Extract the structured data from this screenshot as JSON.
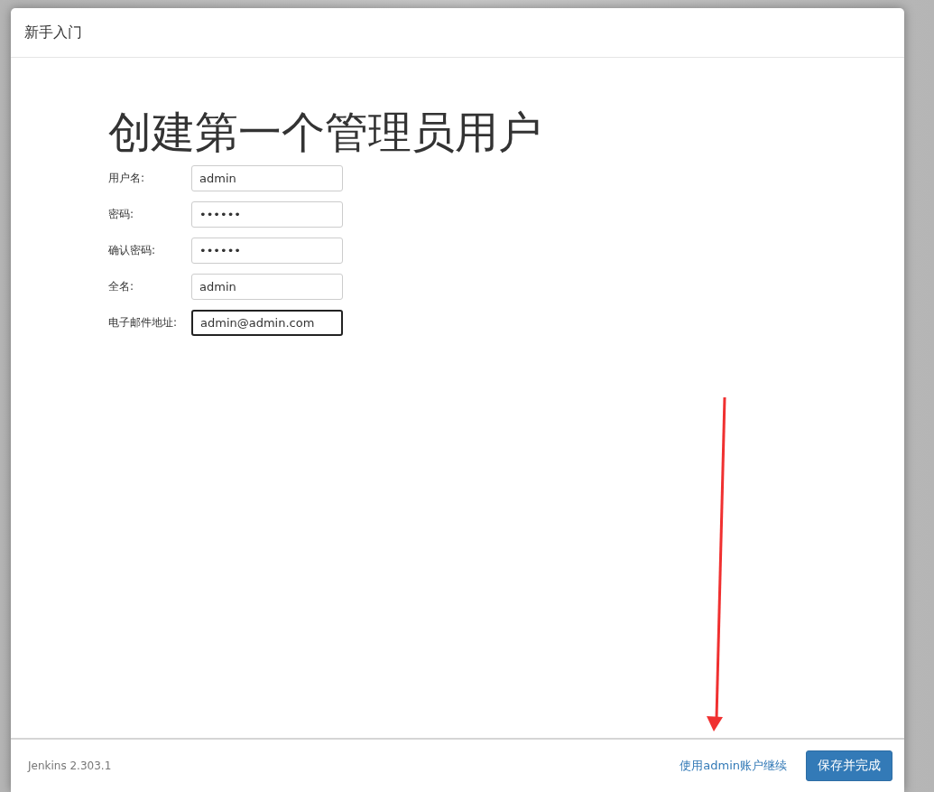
{
  "dialog": {
    "title": "新手入门"
  },
  "heading": "创建第一个管理员用户",
  "fields": [
    {
      "label": "用户名:",
      "value": "admin",
      "focused": false
    },
    {
      "label": "密码:",
      "value": "••••••",
      "focused": false
    },
    {
      "label": "确认密码:",
      "value": "••••••",
      "focused": false
    },
    {
      "label": "全名:",
      "value": "admin",
      "focused": false
    },
    {
      "label": "电子邮件地址:",
      "value": "admin@admin.com",
      "focused": true
    }
  ],
  "footer": {
    "version": "Jenkins 2.303.1",
    "link": "使用admin账户继续",
    "button": "保存并完成"
  }
}
